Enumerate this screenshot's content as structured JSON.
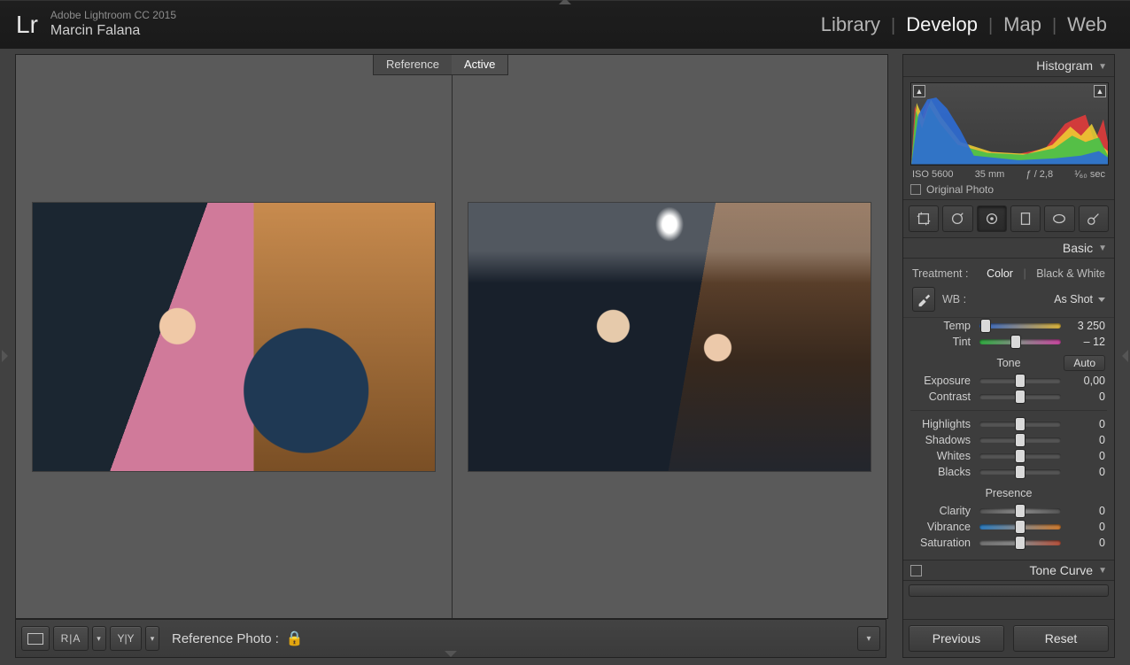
{
  "app": {
    "title": "Adobe Lightroom CC 2015",
    "user": "Marcin Falana"
  },
  "modules": {
    "items": [
      "Library",
      "Develop",
      "Map",
      "Web"
    ],
    "active_index": 1
  },
  "compare": {
    "reference_label": "Reference",
    "active_label": "Active"
  },
  "bottom_toolbar": {
    "ra_label": "R|A",
    "yy_label": "Y|Y",
    "ref_photo_label": "Reference Photo :"
  },
  "right": {
    "histogram": {
      "title": "Histogram",
      "iso": "ISO 5600",
      "focal": "35 mm",
      "aperture": "ƒ / 2,8",
      "shutter": "¹⁄₆₀ sec",
      "original_photo_label": "Original Photo"
    },
    "basic": {
      "title": "Basic",
      "treatment_label": "Treatment :",
      "color_label": "Color",
      "bw_label": "Black & White",
      "wb_label": "WB :",
      "wb_value": "As Shot",
      "tone_label": "Tone",
      "auto_label": "Auto",
      "presence_label": "Presence",
      "sliders": {
        "temp": {
          "label": "Temp",
          "value": "3 250",
          "pos": 8
        },
        "tint": {
          "label": "Tint",
          "value": "– 12",
          "pos": 45
        },
        "exposure": {
          "label": "Exposure",
          "value": "0,00",
          "pos": 50
        },
        "contrast": {
          "label": "Contrast",
          "value": "0",
          "pos": 50
        },
        "highlights": {
          "label": "Highlights",
          "value": "0",
          "pos": 50
        },
        "shadows": {
          "label": "Shadows",
          "value": "0",
          "pos": 50
        },
        "whites": {
          "label": "Whites",
          "value": "0",
          "pos": 50
        },
        "blacks": {
          "label": "Blacks",
          "value": "0",
          "pos": 50
        },
        "clarity": {
          "label": "Clarity",
          "value": "0",
          "pos": 50
        },
        "vibrance": {
          "label": "Vibrance",
          "value": "0",
          "pos": 50
        },
        "saturation": {
          "label": "Saturation",
          "value": "0",
          "pos": 50
        }
      }
    },
    "tone_curve": {
      "title": "Tone Curve"
    },
    "buttons": {
      "previous": "Previous",
      "reset": "Reset"
    }
  }
}
